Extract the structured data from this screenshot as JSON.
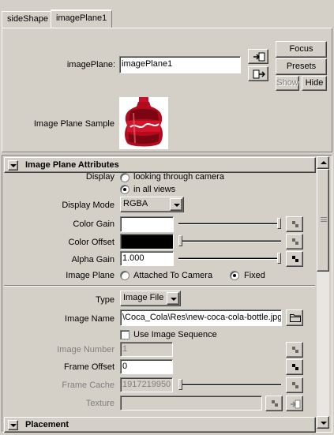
{
  "tabs": [
    {
      "label": "sideShape",
      "active": false
    },
    {
      "label": "imagePlane1",
      "active": true
    }
  ],
  "header": {
    "node_label": "imagePlane:",
    "node_value": "imagePlane1",
    "focus_label": "Focus",
    "presets_label": "Presets",
    "show_label": "Show",
    "hide_label": "Hide",
    "sample_label": "Image Plane Sample",
    "sample_icon": "cola-bottle-icon"
  },
  "attributes": {
    "title": "Image Plane Attributes",
    "display_label": "Display",
    "display_options": [
      "looking through camera",
      "in all views"
    ],
    "display_selected": 1,
    "display_mode_label": "Display Mode",
    "display_mode_value": "RGBA",
    "color_gain_label": "Color Gain",
    "color_gain_swatch": "#ffffff",
    "color_gain_slider": 1.0,
    "color_offset_label": "Color Offset",
    "color_offset_swatch": "#000000",
    "color_offset_slider": 0.0,
    "alpha_gain_label": "Alpha Gain",
    "alpha_gain_value": "1.000",
    "alpha_gain_slider": 1.0,
    "image_plane_label": "Image Plane",
    "image_plane_options": [
      "Attached To Camera",
      "Fixed"
    ],
    "image_plane_selected": 1,
    "type_label": "Type",
    "type_value": "Image File",
    "image_name_label": "Image Name",
    "image_name_value": "\\Coca_Cola\\Res\\new-coca-cola-bottle.jpg",
    "use_sequence_label": "Use Image Sequence",
    "use_sequence_checked": false,
    "image_number_label": "Image Number",
    "image_number_value": "1",
    "frame_offset_label": "Frame Offset",
    "frame_offset_value": "0",
    "frame_cache_label": "Frame Cache",
    "frame_cache_value": "1917219950",
    "frame_cache_slider": 0.0,
    "texture_label": "Texture",
    "texture_value": ""
  },
  "placement": {
    "title": "Placement"
  },
  "colors": {
    "panel": "#d4d0c8",
    "shadow": "#808080",
    "highlight": "#ffffff"
  }
}
